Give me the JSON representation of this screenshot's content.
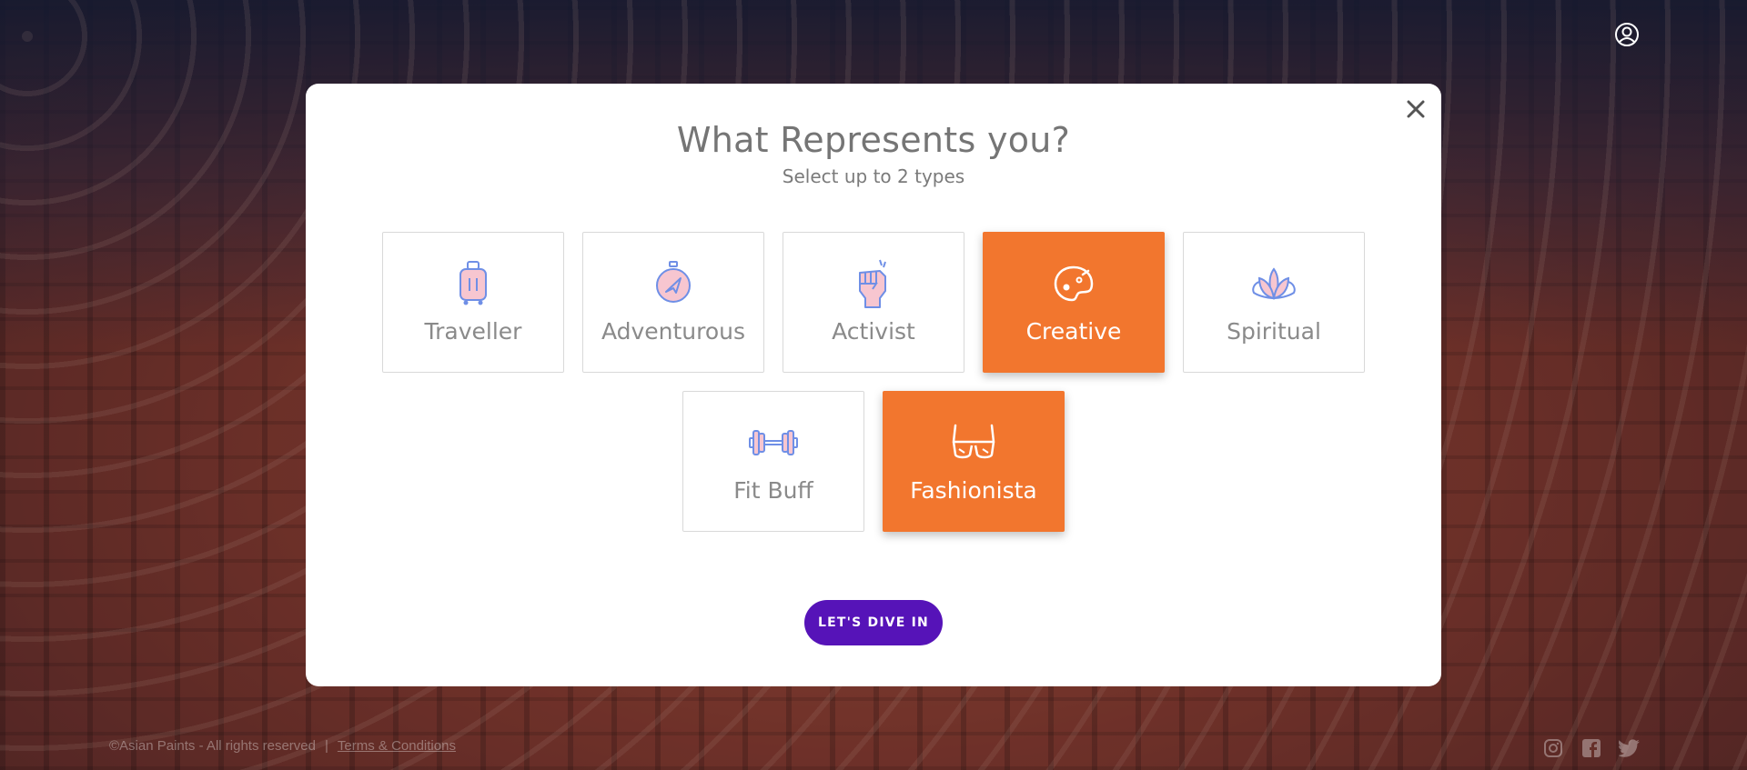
{
  "modal": {
    "title": "What Represents you?",
    "subtitle": "Select up to 2 types",
    "cta_label": "LET'S DIVE IN",
    "close_icon": "close-icon"
  },
  "types": [
    {
      "label": "Traveller",
      "icon": "suitcase-icon",
      "selected": false
    },
    {
      "label": "Adventurous",
      "icon": "compass-icon",
      "selected": false
    },
    {
      "label": "Activist",
      "icon": "raised-fist-icon",
      "selected": false
    },
    {
      "label": "Creative",
      "icon": "paint-palette-icon",
      "selected": true
    },
    {
      "label": "Spiritual",
      "icon": "lotus-icon",
      "selected": false
    },
    {
      "label": "Fit Buff",
      "icon": "dumbbell-icon",
      "selected": false
    },
    {
      "label": "Fashionista",
      "icon": "sunglasses-icon",
      "selected": true
    }
  ],
  "footer": {
    "copyright": "©Asian Paints - All rights reserved",
    "separator": "|",
    "terms_link": "Terms & Conditions",
    "social_icons": [
      "instagram-icon",
      "facebook-icon",
      "twitter-icon"
    ]
  },
  "colors": {
    "accent": "#f2762e",
    "cta": "#5613b8",
    "icon_blue": "#6f8fe6",
    "icon_pink": "#f7c6d0"
  }
}
